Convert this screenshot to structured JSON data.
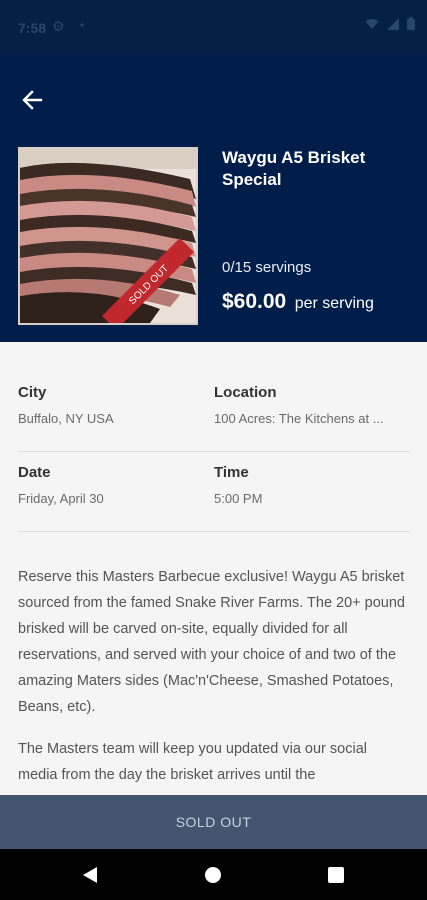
{
  "status_bar": {
    "time": "7:58",
    "icons": [
      "gear-icon",
      "dot-icon",
      "wifi-icon",
      "signal-icon",
      "battery-icon"
    ]
  },
  "header": {
    "back_icon": "arrow-left-icon",
    "title": "Waygu A5 Brisket Special",
    "servings": "0/15 servings",
    "price": "$60.00",
    "per_serving": "per serving",
    "ribbon": "SOLD OUT",
    "background_color": "#001e49"
  },
  "details": {
    "city_label": "City",
    "city_value": "Buffalo, NY USA",
    "location_label": "Location",
    "location_value": "100 Acres: The Kitchens at ...",
    "date_label": "Date",
    "date_value": "Friday, April 30",
    "time_label": "Time",
    "time_value": "5:00 PM",
    "description": [
      "Reserve this Masters Barbecue exclusive!  Waygu A5 brisket sourced from the famed Snake River Farms. The 20+ pound brisked will be carved on-site, equally divided for all reservations, and served with your choice of and two of the amazing Maters sides (Mac'n'Cheese, Smashed Potatoes, Beans, etc).",
      "The Masters team will keep you updated via our social media from the day the brisket arrives until the"
    ]
  },
  "footer": {
    "button_label": "SOLD OUT",
    "button_color": "#45556f"
  },
  "nav": {
    "icons": [
      "back-triangle-icon",
      "home-circle-icon",
      "recents-square-icon"
    ]
  }
}
